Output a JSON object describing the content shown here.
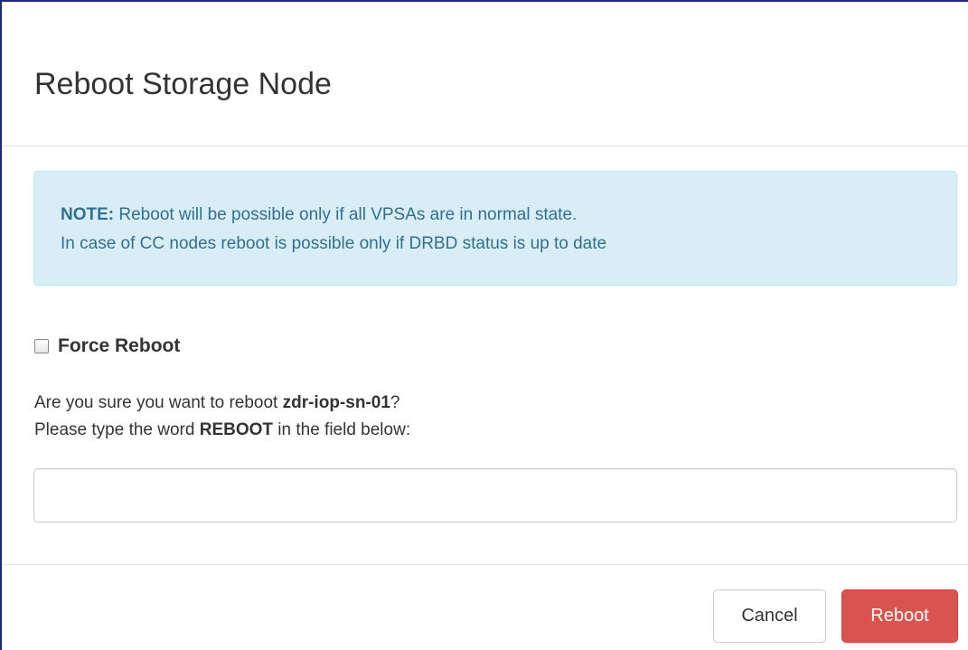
{
  "modal": {
    "title": "Reboot Storage Node"
  },
  "alert": {
    "note_label": "NOTE:",
    "line1": "Reboot will be possible only if all VPSAs are in normal state.",
    "line2": "In case of CC nodes reboot is possible only if DRBD status is up to date"
  },
  "force_reboot": {
    "label": "Force Reboot",
    "checked": false
  },
  "confirm": {
    "prefix": "Are you sure you want to reboot ",
    "node_name": "zdr-iop-sn-01",
    "suffix": "?",
    "line2_prefix": "Please type the word ",
    "keyword": "REBOOT",
    "line2_suffix": " in the field below:"
  },
  "input": {
    "value": "",
    "placeholder": ""
  },
  "footer": {
    "cancel_label": "Cancel",
    "reboot_label": "Reboot"
  },
  "colors": {
    "alert_bg": "#d9edf7",
    "alert_text": "#31708f",
    "danger": "#d9534f"
  }
}
